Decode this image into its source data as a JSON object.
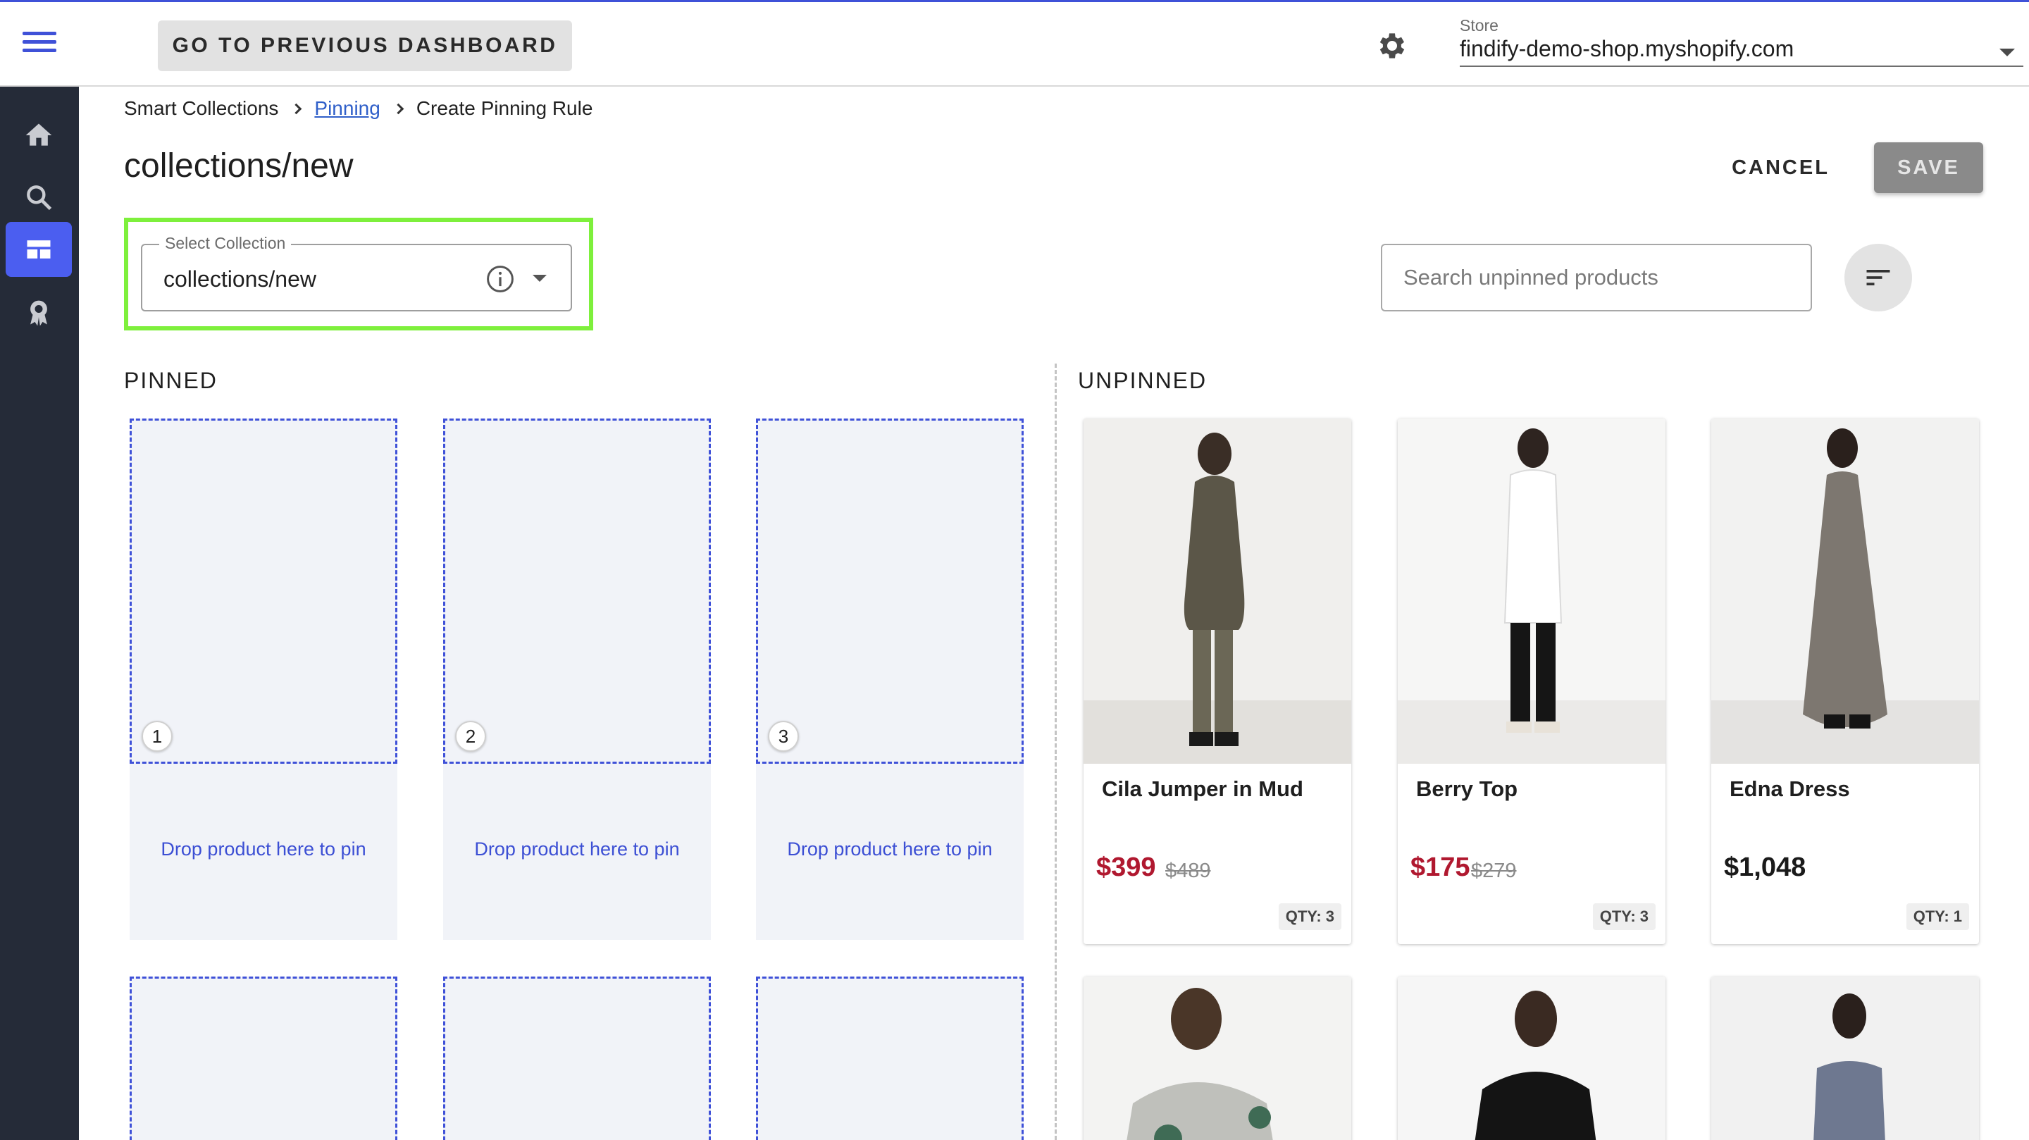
{
  "topbar": {
    "prev_dashboard_label": "GO TO PREVIOUS DASHBOARD",
    "store_label": "Store",
    "store_value": "findify-demo-shop.myshopify.com",
    "accent_color": "#3f51d8"
  },
  "sidebar": {
    "items": [
      {
        "icon": "home-icon",
        "active": false
      },
      {
        "icon": "search-icon",
        "active": false
      },
      {
        "icon": "collections-icon",
        "active": true
      },
      {
        "icon": "badge-icon",
        "active": false
      }
    ],
    "background": "#252b38",
    "active_color": "#4b5ef0"
  },
  "breadcrumb": {
    "items": [
      "Smart Collections",
      "Pinning",
      "Create Pinning Rule"
    ]
  },
  "page": {
    "title": "collections/new",
    "cancel_label": "CANCEL",
    "save_label": "SAVE"
  },
  "select_collection": {
    "label": "Select Collection",
    "value": "collections/new",
    "highlight_color": "#7ef03c"
  },
  "search": {
    "placeholder": "Search unpinned products"
  },
  "pinned": {
    "title": "PINNED",
    "slots": [
      {
        "number": "1",
        "text": "Drop product here to pin"
      },
      {
        "number": "2",
        "text": "Drop product here to pin"
      },
      {
        "number": "3",
        "text": "Drop product here to pin"
      }
    ]
  },
  "unpinned": {
    "title": "UNPINNED",
    "products": [
      {
        "name": "Cila Jumper in Mud",
        "price": "$399",
        "old_price": "$489",
        "qty": "QTY: 3"
      },
      {
        "name": "Berry Top",
        "price": "$175",
        "old_price": "$279",
        "qty": "QTY: 3"
      },
      {
        "name": "Edna Dress",
        "price": "$1,048",
        "old_price": "",
        "qty": "QTY: 1"
      }
    ],
    "sale_color": "#b0182f"
  }
}
